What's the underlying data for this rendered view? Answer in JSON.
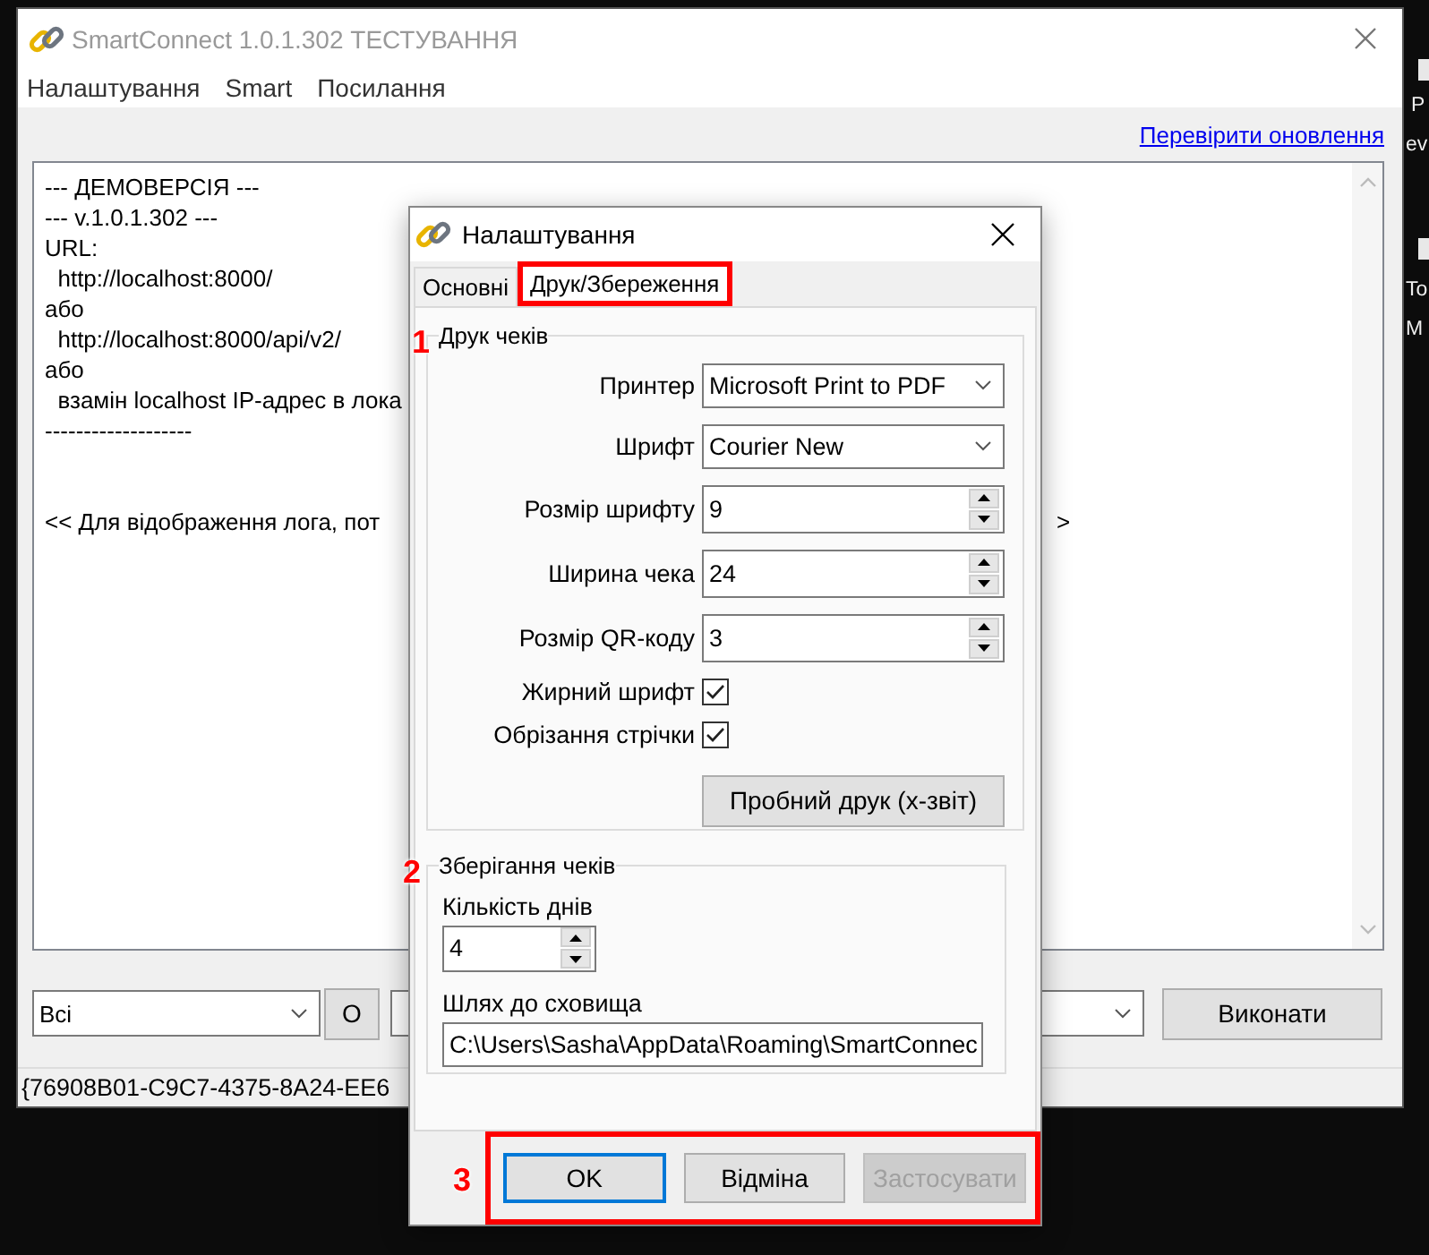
{
  "desktop": {
    "labels": [
      {
        "text": "P"
      },
      {
        "text": "ev"
      },
      {
        "text": "To"
      },
      {
        "text": "M"
      }
    ]
  },
  "window": {
    "title": "SmartConnect 1.0.1.302 ТЕСТУВАННЯ",
    "menu": [
      "Налаштування",
      "Smart",
      "Посилання"
    ],
    "update_link": "Перевірити оновлення",
    "log": [
      {
        "kind": "text",
        "text": "--- ДЕМОВЕРСІЯ ---"
      },
      {
        "kind": "text",
        "text": "--- v.1.0.1.302 ---"
      },
      {
        "kind": "text",
        "text": "URL:"
      },
      {
        "kind": "text",
        "text": "  http://localhost:8000/"
      },
      {
        "kind": "text",
        "text": "або"
      },
      {
        "kind": "text",
        "text": "  http://localhost:8000/api/v2/"
      },
      {
        "kind": "text",
        "text": "або"
      },
      {
        "kind": "text",
        "text": "  взамін localhost IP-адрес в лока"
      },
      {
        "kind": "text",
        "text": "-------------------"
      },
      {
        "kind": "blank"
      },
      {
        "kind": "blank"
      },
      {
        "kind": "text",
        "text": "<< Для відображення лога, пот",
        "tail": ">"
      }
    ],
    "filter": "Всі",
    "filter_button": "О",
    "run_button": "Виконати",
    "status": "{76908B01-C9C7-4375-8A24-EE6"
  },
  "dialog": {
    "title": "Налаштування",
    "tabs": [
      {
        "label": "Основні",
        "selected": false,
        "highlighted": false
      },
      {
        "label": "Друк/Збереження",
        "selected": true,
        "highlighted": true
      }
    ],
    "print_group": {
      "title": "Друк чеків",
      "marker": "1",
      "fields": [
        {
          "kind": "combo",
          "label": "Принтер",
          "value": "Microsoft Print to PDF"
        },
        {
          "kind": "combo",
          "label": "Шрифт",
          "value": "Courier New"
        },
        {
          "kind": "spin",
          "label": "Розмір шрифту",
          "value": "9"
        },
        {
          "kind": "spin",
          "label": "Ширина чека",
          "value": "24"
        },
        {
          "kind": "spin",
          "label": "Розмір QR-коду",
          "value": "3"
        },
        {
          "kind": "checkbox",
          "label": "Жирний шрифт",
          "checked": true
        },
        {
          "kind": "checkbox",
          "label": "Обрізання стрічки",
          "checked": true
        }
      ],
      "test_button": "Пробний друк (х-звіт)"
    },
    "storage_group": {
      "title": "Зберігання чеків",
      "marker": "2",
      "days_label": "Кількість днів",
      "days": "4",
      "path_label": "Шлях до сховища",
      "path": "C:\\Users\\Sasha\\AppData\\Roaming\\SmartConnec"
    },
    "button_bar": {
      "marker": "3",
      "highlighted": true,
      "buttons": [
        {
          "label": "OK",
          "default": true,
          "disabled": false
        },
        {
          "label": "Відміна",
          "default": false,
          "disabled": false
        },
        {
          "label": "Застосувати",
          "default": false,
          "disabled": true
        }
      ]
    }
  }
}
